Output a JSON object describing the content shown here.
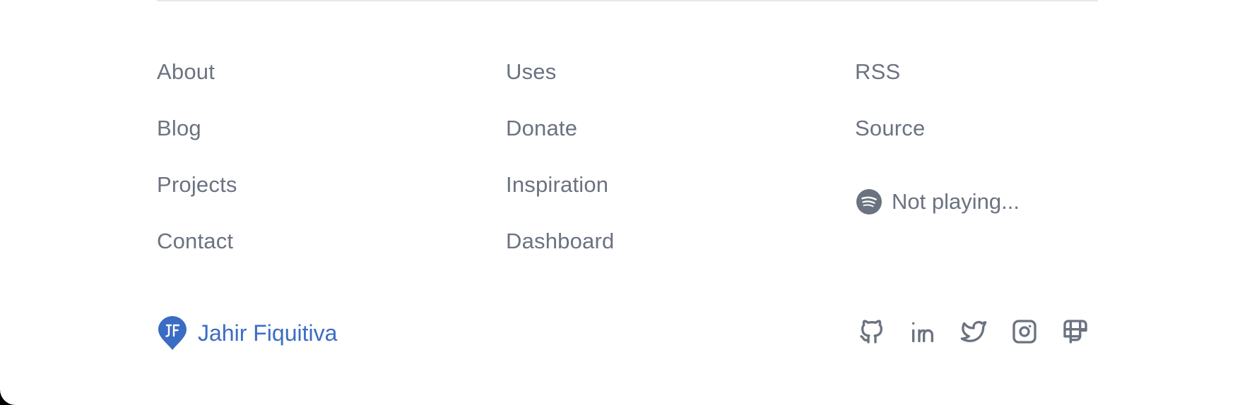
{
  "footer": {
    "nav_col1": [
      {
        "label": "About"
      },
      {
        "label": "Blog"
      },
      {
        "label": "Projects"
      },
      {
        "label": "Contact"
      }
    ],
    "nav_col2": [
      {
        "label": "Uses"
      },
      {
        "label": "Donate"
      },
      {
        "label": "Inspiration"
      },
      {
        "label": "Dashboard"
      }
    ],
    "nav_col3": [
      {
        "label": "RSS"
      },
      {
        "label": "Source"
      }
    ],
    "spotify": {
      "icon": "spotify-icon",
      "status": "Not playing..."
    },
    "brand": {
      "logo": "jf-logo-icon",
      "name": "Jahir Fiquitiva",
      "color": "#3b6cc3"
    },
    "socials": [
      {
        "icon": "github-icon"
      },
      {
        "icon": "linkedin-icon"
      },
      {
        "icon": "twitter-icon"
      },
      {
        "icon": "instagram-icon"
      },
      {
        "icon": "polywork-icon"
      }
    ],
    "text_color": "#6b7280"
  }
}
